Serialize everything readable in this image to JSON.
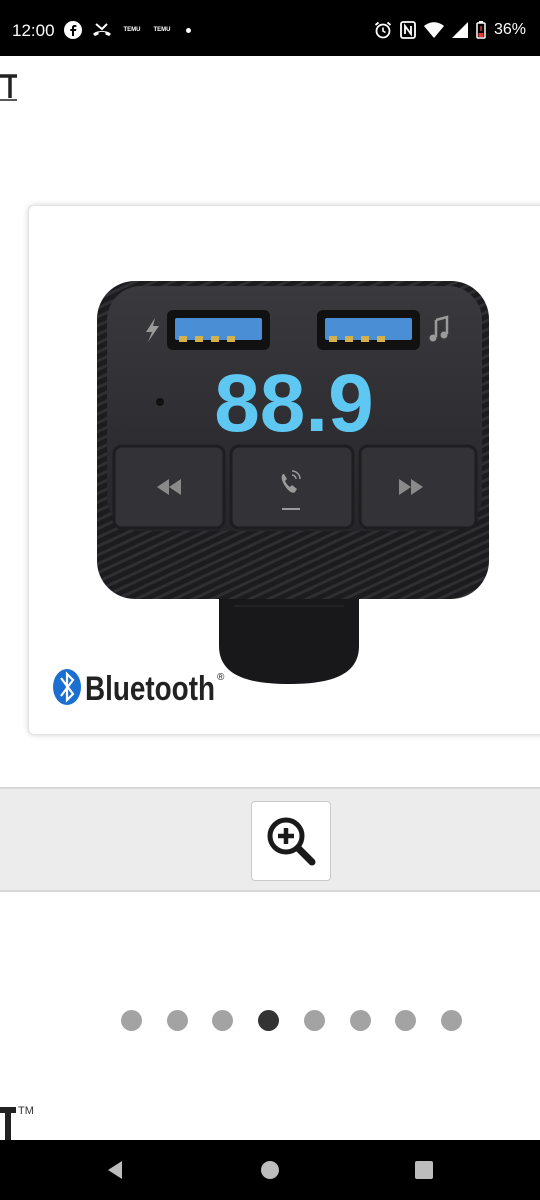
{
  "status_bar": {
    "time": "12:00",
    "temu_label_1": "TEMU",
    "temu_label_2": "TEMU",
    "battery_percent": "36%",
    "icons": [
      "facebook-icon",
      "missed-call-icon",
      "temu-icon",
      "temu-icon",
      "notification-dot",
      "alarm-icon",
      "nfc-icon",
      "wifi-icon",
      "signal-icon",
      "battery-icon"
    ]
  },
  "product": {
    "image_alt": "Bluetooth FM transmitter",
    "display_frequency": "88.9",
    "brand_logo_text": "Bluetooth",
    "registered_mark": "®",
    "icons": [
      "charge-icon",
      "music-note-icon",
      "rewind-icon",
      "phone-call-icon",
      "fast-forward-icon",
      "bluetooth-icon"
    ]
  },
  "zoom": {
    "icon": "zoom-in-icon"
  },
  "pager": {
    "count": 8,
    "active_index": 3
  },
  "footer": {
    "trademark": "TM"
  },
  "nav_bar": {
    "icons": [
      "back-icon",
      "home-icon",
      "recents-icon"
    ]
  },
  "colors": {
    "display_blue": "#5ec8f2",
    "device_body": "#2b2b2e",
    "active_dot": "#333333",
    "inactive_dot": "#a3a3a3"
  }
}
